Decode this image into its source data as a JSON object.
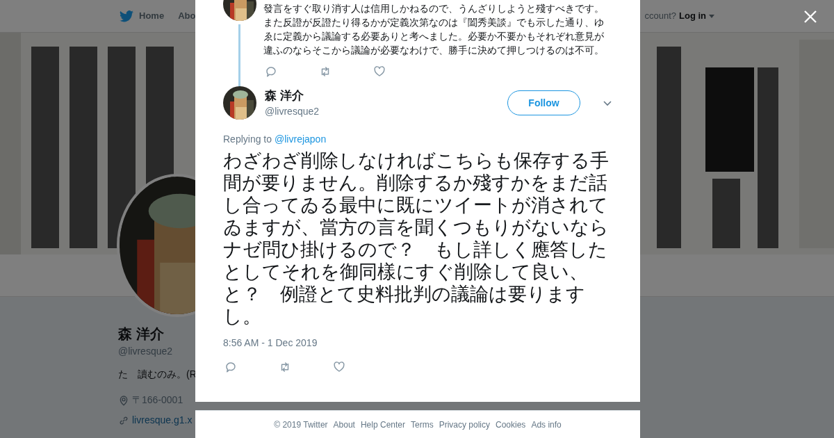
{
  "background_page": {
    "nav": {
      "home": "Home",
      "about": "Abo",
      "account_prompt": "ccount?",
      "login": "Log in"
    },
    "profile": {
      "name": "森 洋介",
      "handle": "@livresque2",
      "bio": "た　讀むのみ。(R",
      "location": "〒166-0001",
      "url": "livresque.g1.x"
    }
  },
  "modal": {
    "previous_tweet": {
      "text": "發言をすぐ取り消す人は信用しかねるので、うんざりしようと殘すべきです。また反證が反證たり得るかが定義次第なのは『闔秀美談』でも示した通り、ゆゑに定義から議論する必要ありと考へました。必要か不要かもそれぞれ意見が違ふのならそこから議論が必要なわけで、勝手に決めて押しつけるのは不可。"
    },
    "tweet": {
      "name": "森 洋介",
      "handle": "@livresque2",
      "follow_button": "Follow",
      "replying_label": "Replying to",
      "replying_to": "@livrejapon",
      "text": "わざわざ削除しなければこちらも保存する手間が要りません。削除するか殘すかをまだ話し合ってゐる最中に既にツイートが消されてゐますが、當方の言を聞くつもりがないならナゼ問ひ掛けるので？　もし詳しく應答したとしてそれを御同樣にすぐ削除して良い、と？　例證とて史料批判の議論は要りますし。",
      "timestamp": "8:56 AM - 1 Dec 2019"
    }
  },
  "footer": {
    "links": [
      "© 2019 Twitter",
      "About",
      "Help Center",
      "Terms",
      "Privacy policy",
      "Cookies",
      "Ads info"
    ]
  }
}
